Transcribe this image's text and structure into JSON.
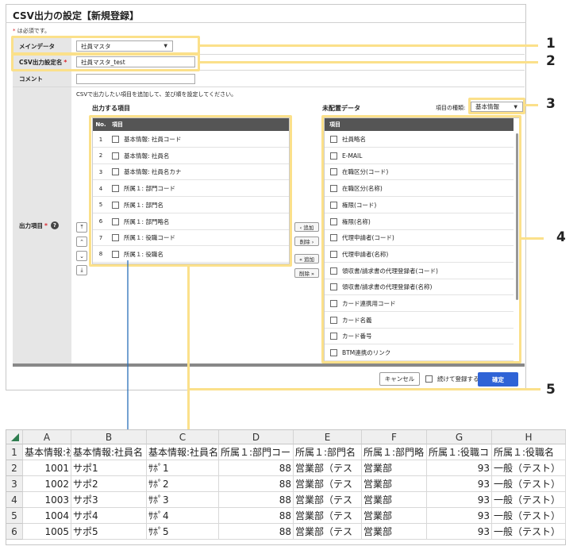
{
  "form": {
    "title": "CSV出力の設定【新規登録】",
    "required_star": "*",
    "required_note": " は必須です。",
    "main_data_label": "メインデータ",
    "main_data_value": "社員マスタ",
    "csv_name_label": "CSV出力設定名",
    "csv_name_value": "社員マスタ_test",
    "comment_label": "コメント",
    "comment_value": "",
    "output_items_label": "出力項目",
    "help_icon": "?",
    "instruction": "CSVで出力したい項目を追加して、並び順を設定してください。",
    "output_section_title": "出力する項目",
    "unassigned_section_title": "未配置データ",
    "item_type_label": "項目の種類:",
    "item_type_value": "基本情報",
    "output_header_no": "No.",
    "output_header_item": "項目",
    "unassigned_header_item": "項目",
    "output_items": [
      {
        "no": "1",
        "label": "基本情報: 社員コード"
      },
      {
        "no": "2",
        "label": "基本情報: 社員名"
      },
      {
        "no": "3",
        "label": "基本情報: 社員名カナ"
      },
      {
        "no": "4",
        "label": "所属１: 部門コード"
      },
      {
        "no": "5",
        "label": "所属１: 部門名"
      },
      {
        "no": "6",
        "label": "所属１: 部門略名"
      },
      {
        "no": "7",
        "label": "所属１: 役職コード"
      },
      {
        "no": "8",
        "label": "所属１: 役職名"
      }
    ],
    "unassigned_items": [
      "社員略名",
      "E-MAIL",
      "在職区分(コード)",
      "在職区分(名称)",
      "権限(コード)",
      "権限(名称)",
      "代理申請者(コード)",
      "代理申請者(名称)",
      "領収書/請求書の代理登録者(コード)",
      "領収書/請求書の代理登録者(名称)",
      "カード連携用コード",
      "カード名義",
      "カード番号",
      "BTM連携のリンク"
    ],
    "btn_add_top": "‹ 追加",
    "btn_remove_top": "削除 ›",
    "btn_add_all": "« 追加",
    "btn_remove_all": "削除 »",
    "order_top": "⤒",
    "order_up": "⌃",
    "order_down": "⌄",
    "order_bottom": "⤓",
    "cancel_label": "キャンセル",
    "continue_label": "続けて登録する",
    "confirm_label": "確定"
  },
  "callouts": [
    "1",
    "2",
    "3",
    "4",
    "5"
  ],
  "sheet": {
    "columns": [
      "A",
      "B",
      "C",
      "D",
      "E",
      "F",
      "G",
      "H"
    ],
    "row_numbers": [
      "1",
      "2",
      "3",
      "4",
      "5",
      "6"
    ],
    "header_row": [
      "基本情報:社",
      "基本情報:社員名",
      "基本情報:社員名",
      "所属１:部門コー",
      "所属１:部門名",
      "所属１:部門略",
      "所属１:役職コ",
      "所属１:役職名"
    ],
    "rows": [
      [
        "1001",
        "サポ1",
        "ｻﾎﾟ1",
        "88",
        "営業部（テス",
        "営業部",
        "93",
        "一般（テスト）"
      ],
      [
        "1002",
        "サポ2",
        "ｻﾎﾟ2",
        "88",
        "営業部（テス",
        "営業部",
        "93",
        "一般（テスト）"
      ],
      [
        "1003",
        "サポ3",
        "ｻﾎﾟ3",
        "88",
        "営業部（テス",
        "営業部",
        "93",
        "一般（テスト）"
      ],
      [
        "1004",
        "サポ4",
        "ｻﾎﾟ4",
        "88",
        "営業部（テス",
        "営業部",
        "93",
        "一般（テスト）"
      ],
      [
        "1005",
        "サポ5",
        "ｻﾎﾟ5",
        "88",
        "営業部（テス",
        "営業部",
        "93",
        "一般（テスト）"
      ]
    ]
  },
  "colors": {
    "highlight": "#fbe08a",
    "primary_button": "#2f63d6",
    "list_header": "#555555",
    "arrow": "#2a6fb8"
  }
}
